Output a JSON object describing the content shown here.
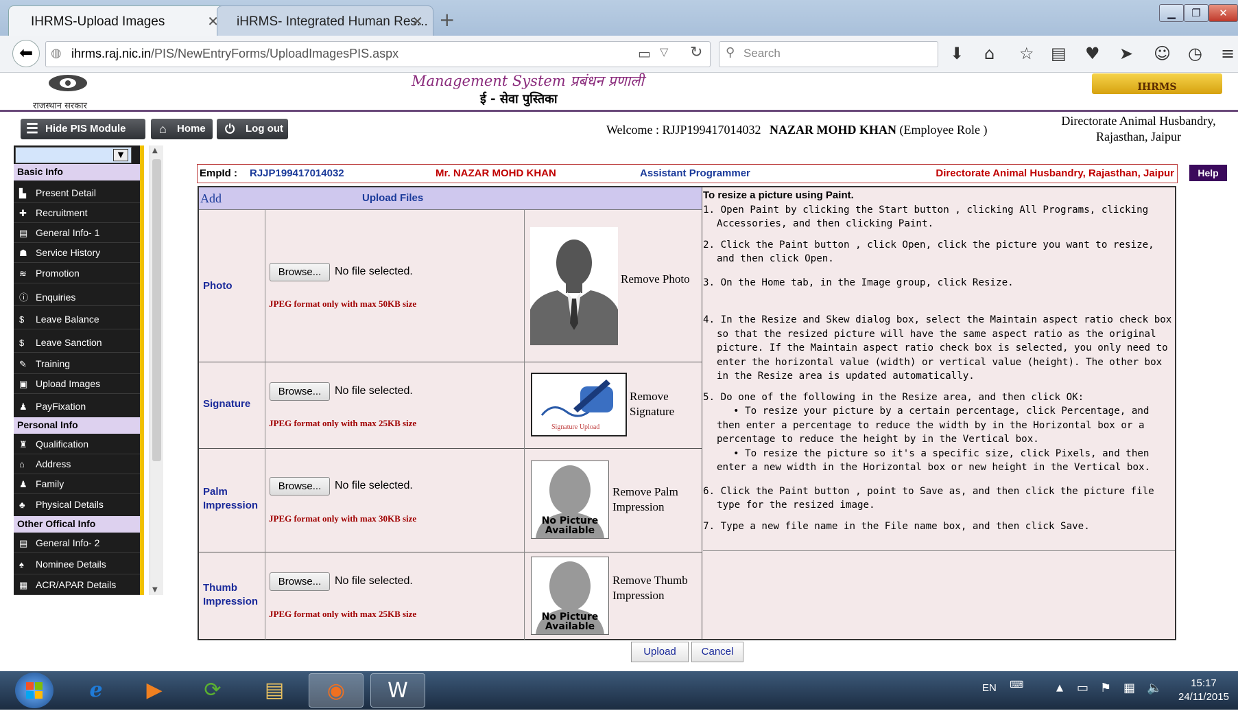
{
  "browser": {
    "tabs": [
      {
        "label": "IHRMS-Upload Images"
      },
      {
        "label": "iHRMS- Integrated Human Res..."
      }
    ],
    "url_host": "ihrms.raj.nic.in",
    "url_path": "/PIS/NewEntryForms/UploadImagesPIS.aspx",
    "search_placeholder": "Search"
  },
  "header": {
    "state_label": "राजस्थान सरकार",
    "mgmt_text": "Management System प्रबंधन प्रणाली",
    "seva_text": "ई - सेवा पुस्तिका",
    "logo_text": "IHRMS"
  },
  "topbar": {
    "hide_label": "Hide PIS Module",
    "home_label": "Home",
    "logout_label": "Log out",
    "welcome_prefix": "Welcome : RJJP199417014032",
    "welcome_name": "NAZAR MOHD KHAN",
    "welcome_role": "(Employee Role )",
    "dept_line1": "Directorate Animal Husbandry,",
    "dept_line2": "Rajasthan, Jaipur"
  },
  "sidebar": {
    "sections": [
      {
        "title": "Basic Info"
      },
      {
        "title": "Personal Info"
      },
      {
        "title": "Other Offical Info"
      }
    ],
    "items": [
      {
        "label": "Present Detail",
        "icon": "▙"
      },
      {
        "label": "Recruitment",
        "icon": "✚"
      },
      {
        "label": "General Info- 1",
        "icon": "▤"
      },
      {
        "label": "Service History",
        "icon": "☗"
      },
      {
        "label": "Promotion",
        "icon": "≋"
      },
      {
        "label": "Enquiries",
        "icon": "ⓘ"
      },
      {
        "label": "Leave Balance",
        "icon": "$"
      },
      {
        "label": "Leave Sanction",
        "icon": "$"
      },
      {
        "label": "Training",
        "icon": "✎"
      },
      {
        "label": "Upload Images",
        "icon": "▣"
      },
      {
        "label": "PayFixation",
        "icon": "♟"
      },
      {
        "label": "Qualification",
        "icon": "♜"
      },
      {
        "label": "Address",
        "icon": "⌂"
      },
      {
        "label": "Family",
        "icon": "♟"
      },
      {
        "label": "Physical Details",
        "icon": "♣"
      },
      {
        "label": "General Info- 2",
        "icon": "▤"
      },
      {
        "label": "Nominee Details",
        "icon": "♠"
      },
      {
        "label": "ACR/APAR Details",
        "icon": "▦"
      }
    ]
  },
  "empbar": {
    "empid_label": "EmpId :",
    "empid": "RJJP199417014032",
    "name": "Mr. NAZAR MOHD KHAN",
    "designation": "Assistant Programmer",
    "office": "Directorate Animal Husbandry, Rajasthan, Jaipur",
    "help_label": "Help"
  },
  "table": {
    "add_label": "Add",
    "upload_files_label": "Upload Files",
    "browse_label": "Browse...",
    "no_file_text": "No file selected.",
    "rows": [
      {
        "label": "Photo",
        "format": "JPEG format only with max 50KB size",
        "remove": "Remove Photo"
      },
      {
        "label": "Signature",
        "format": "JPEG format only with max 25KB size",
        "remove": "Remove Signature",
        "image_caption": "Signature Upload"
      },
      {
        "label": "Palm Impression",
        "format": "JPEG format only with max 30KB size",
        "remove": "Remove Palm Impression",
        "image_caption": "No Picture Available"
      },
      {
        "label": "Thumb Impression",
        "format": "JPEG format only with max 25KB size",
        "remove": "Remove Thumb Impression",
        "image_caption": "No Picture Available"
      }
    ]
  },
  "help": {
    "title": "To resize a picture using Paint.",
    "steps": [
      "1. Open Paint by clicking the Start button , clicking All Programs, clicking Accessories, and then clicking Paint.",
      "2. Click the Paint button , click Open, click the picture you want to resize, and then click Open.",
      "3. On the Home tab, in the Image group, click Resize.",
      "4. In the Resize and Skew dialog box, select the Maintain aspect ratio check box so that the resized picture will have the same aspect ratio as the original picture. If the Maintain aspect ratio check box is selected, you only need to enter the horizontal value (width) or vertical value (height). The other box in the Resize area is updated automatically.",
      "5. Do one of the following in the Resize area, and then click OK:",
      "• To resize your picture by a certain percentage, click Percentage, and then enter a percentage to reduce the width by in the Horizontal box or a percentage to reduce the height by in the Vertical box.",
      "• To resize the picture so it's a specific size, click Pixels, and then enter a new width in the Horizontal box or new height in the Vertical box.",
      "6. Click the Paint button , point to Save as, and then click the picture file type for the resized image.",
      "7. Type a new file name in the File name box, and then click Save."
    ]
  },
  "actions": {
    "upload_label": "Upload",
    "cancel_label": "Cancel"
  },
  "taskbar": {
    "lang": "EN",
    "time": "15:17",
    "date": "24/11/2015"
  }
}
